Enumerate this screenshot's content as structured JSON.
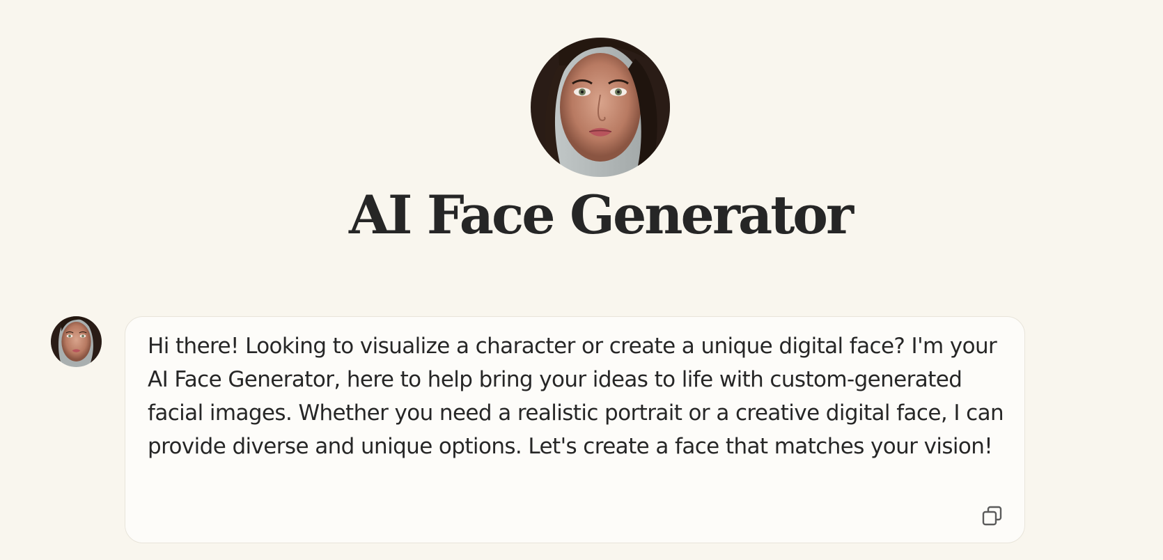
{
  "page": {
    "title": "AI Face Generator"
  },
  "hero": {
    "avatar_icon": "portrait-avatar-icon"
  },
  "chat": {
    "messages": [
      {
        "role": "assistant",
        "avatar_icon": "portrait-avatar-icon",
        "text": "Hi there! Looking to visualize a character or create a unique digital face? I'm your AI Face Generator, here to help bring your ideas to life with custom-generated facial images. Whether you need a realistic portrait or a creative digital face, I can provide diverse and unique options. Let's create a face that matches your vision!",
        "actions": {
          "copy_icon": "copy-icon"
        }
      }
    ]
  },
  "colors": {
    "background": "#f9f6ee",
    "bubble_background": "#fdfcf9",
    "bubble_border": "#e8e4da",
    "text": "#262626"
  }
}
